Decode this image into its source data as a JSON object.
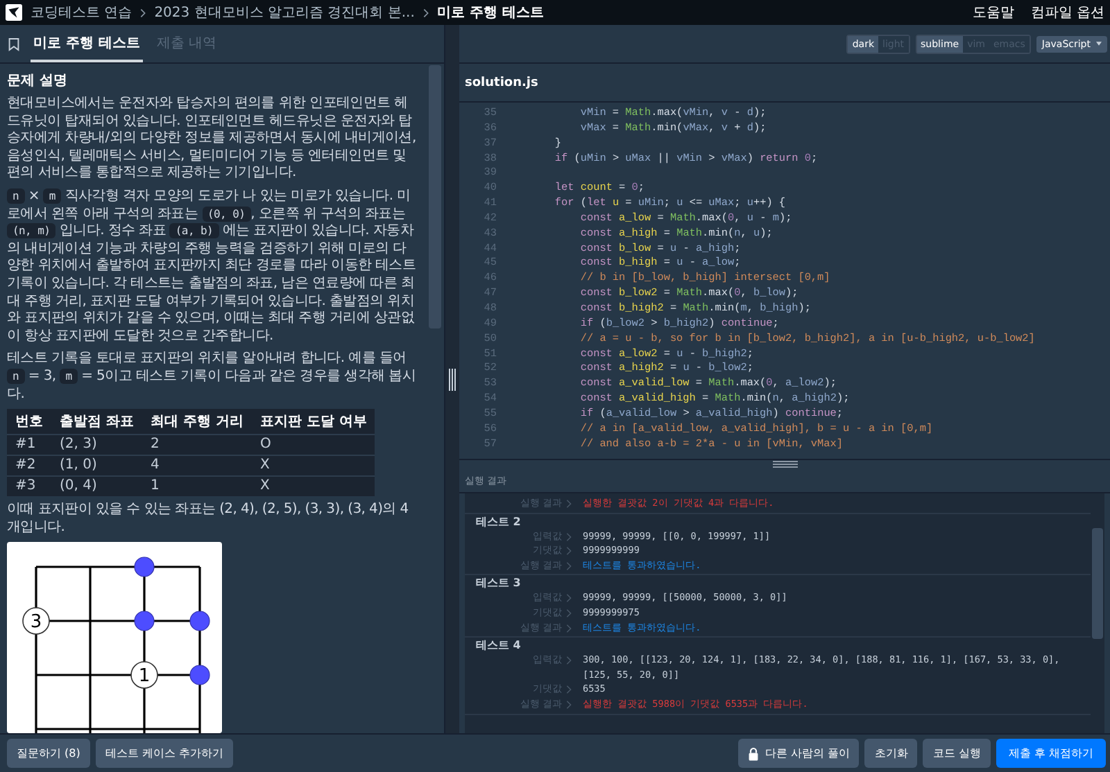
{
  "topbar": {
    "breadcrumbs": [
      {
        "label": "코딩테스트 연습",
        "current": false
      },
      {
        "label": "2023 현대모비스 알고리즘 경진대회 본...",
        "current": false
      },
      {
        "label": "미로 주행 테스트",
        "current": true
      }
    ],
    "links": [
      "도움말",
      "컴파일 옵션"
    ]
  },
  "left_tabs": [
    {
      "label": "미로 주행 테스트",
      "selected": true
    },
    {
      "label": "제출 내역",
      "selected": false
    }
  ],
  "problem": {
    "heading": "문제 설명",
    "paragraphs": [
      [
        {
          "kind": "text",
          "text": "현대모비스에서는 운전자와 탑승자의 편의를 위한 인포테인먼트 헤드유닛이 탑재되어 있습니다. 인포테인먼트 헤드유닛은 운전자와 탑승자에게 차량내/외의 다양한 정보를 제공하면서 동시에 내비게이션, 음성인식, 텔레매틱스 서비스, 멀티미디어 기능 등 엔터테인먼트 및 편의 서비스를 통합적으로 제공하는 기기입니다."
        }
      ],
      [
        {
          "kind": "code",
          "text": "n"
        },
        {
          "kind": "text",
          "text": " × "
        },
        {
          "kind": "code",
          "text": "m"
        },
        {
          "kind": "text",
          "text": " 직사각형 격자 모양의 도로가 나 있는 미로가 있습니다. 미로에서 왼쪽 아래 구석의 좌표는 "
        },
        {
          "kind": "code",
          "text": "(0, 0)"
        },
        {
          "kind": "text",
          "text": ", 오른쪽 위 구석의 좌표는 "
        },
        {
          "kind": "code",
          "text": "(n, m)"
        },
        {
          "kind": "text",
          "text": " 입니다. 정수 좌표 "
        },
        {
          "kind": "code",
          "text": "(a, b)"
        },
        {
          "kind": "text",
          "text": " 에는 표지판이 있습니다. 자동차의 내비게이션 기능과 차량의 주행 능력을 검증하기 위해 미로의 다양한 위치에서 출발하여 표지판까지 최단 경로를 따라 이동한 테스트 기록이 있습니다. 각 테스트는 출발점의 좌표, 남은 연료량에 따른 최대 주행 거리, 표지판 도달 여부가 기록되어 있습니다. 출발점의 위치와 표지판의 위치가 같을 수 있으며, 이때는 최대 주행 거리에 상관없이 항상 표지판에 도달한 것으로 간주합니다."
        }
      ],
      [
        {
          "kind": "text",
          "text": "테스트 기록을 토대로 표지판의 위치를 알아내려 합니다. 예를 들어 "
        },
        {
          "kind": "code",
          "text": "n"
        },
        {
          "kind": "text",
          "text": " = 3, "
        },
        {
          "kind": "code",
          "text": "m"
        },
        {
          "kind": "text",
          "text": " = 5이고 테스트 기록이 다음과 같은 경우를 생각해 봅시다."
        }
      ]
    ],
    "table": {
      "columns": [
        "번호",
        "출발점 좌표",
        "최대 주행 거리",
        "표지판 도달 여부"
      ],
      "rows": [
        [
          "#1",
          "(2, 3)",
          "2",
          "O"
        ],
        [
          "#2",
          "(1, 0)",
          "4",
          "X"
        ],
        [
          "#3",
          "(0, 4)",
          "1",
          "X"
        ]
      ]
    },
    "note": "이때 표지판이 있을 수 있는 좌표는 (2, 4), (2, 5), (3, 3), (3, 4)의 4개입니다.",
    "figure": {
      "nodes": [
        {
          "label": "3"
        },
        {
          "label": "1"
        }
      ]
    }
  },
  "editor": {
    "themes": [
      {
        "label": "dark",
        "selected": true
      },
      {
        "label": "light",
        "selected": false
      }
    ],
    "keymaps": [
      {
        "label": "sublime",
        "selected": true
      },
      {
        "label": "vim",
        "selected": false
      },
      {
        "label": "emacs",
        "selected": false
      }
    ],
    "language": "JavaScript",
    "file": "solution.js",
    "lines": [
      {
        "num": "35",
        "tokens": [
          {
            "kind": "i",
            "text": "            vMin"
          },
          {
            "kind": "p",
            "text": " = "
          },
          {
            "kind": "c",
            "text": "Math"
          },
          {
            "kind": "p",
            "text": ".max("
          },
          {
            "kind": "i",
            "text": "vMin"
          },
          {
            "kind": "p",
            "text": ", "
          },
          {
            "kind": "i",
            "text": "v"
          },
          {
            "kind": "p",
            "text": " - "
          },
          {
            "kind": "i",
            "text": "d"
          },
          {
            "kind": "p",
            "text": ");"
          }
        ]
      },
      {
        "num": "36",
        "tokens": [
          {
            "kind": "i",
            "text": "            vMax"
          },
          {
            "kind": "p",
            "text": " = "
          },
          {
            "kind": "c",
            "text": "Math"
          },
          {
            "kind": "p",
            "text": ".min("
          },
          {
            "kind": "i",
            "text": "vMax"
          },
          {
            "kind": "p",
            "text": ", "
          },
          {
            "kind": "i",
            "text": "v"
          },
          {
            "kind": "p",
            "text": " + "
          },
          {
            "kind": "i",
            "text": "d"
          },
          {
            "kind": "p",
            "text": ");"
          }
        ]
      },
      {
        "num": "37",
        "tokens": [
          {
            "kind": "p",
            "text": "        }"
          }
        ]
      },
      {
        "num": "38",
        "tokens": [
          {
            "kind": "k",
            "text": "        if"
          },
          {
            "kind": "p",
            "text": " ("
          },
          {
            "kind": "i",
            "text": "uMin"
          },
          {
            "kind": "p",
            "text": " > "
          },
          {
            "kind": "i",
            "text": "uMax"
          },
          {
            "kind": "p",
            "text": " || "
          },
          {
            "kind": "i",
            "text": "vMin"
          },
          {
            "kind": "p",
            "text": " > "
          },
          {
            "kind": "i",
            "text": "vMax"
          },
          {
            "kind": "p",
            "text": ") "
          },
          {
            "kind": "k",
            "text": "return"
          },
          {
            "kind": "n",
            "text": " 0"
          },
          {
            "kind": "p",
            "text": ";"
          }
        ]
      },
      {
        "num": "39"
      },
      {
        "num": "40",
        "tokens": [
          {
            "kind": "k",
            "text": "        let"
          },
          {
            "kind": "d",
            "text": " count"
          },
          {
            "kind": "p",
            "text": " = "
          },
          {
            "kind": "n",
            "text": "0"
          },
          {
            "kind": "p",
            "text": ";"
          }
        ]
      },
      {
        "num": "41",
        "tokens": [
          {
            "kind": "k",
            "text": "        for"
          },
          {
            "kind": "p",
            "text": " ("
          },
          {
            "kind": "k",
            "text": "let"
          },
          {
            "kind": "d",
            "text": " u"
          },
          {
            "kind": "p",
            "text": " = "
          },
          {
            "kind": "i",
            "text": "uMin"
          },
          {
            "kind": "p",
            "text": "; "
          },
          {
            "kind": "i",
            "text": "u"
          },
          {
            "kind": "p",
            "text": " <= "
          },
          {
            "kind": "i",
            "text": "uMax"
          },
          {
            "kind": "p",
            "text": "; "
          },
          {
            "kind": "i",
            "text": "u"
          },
          {
            "kind": "p",
            "text": "++) {"
          }
        ]
      },
      {
        "num": "42",
        "tokens": [
          {
            "kind": "k",
            "text": "            const"
          },
          {
            "kind": "d",
            "text": " a_low"
          },
          {
            "kind": "p",
            "text": " = "
          },
          {
            "kind": "c",
            "text": "Math"
          },
          {
            "kind": "p",
            "text": ".max("
          },
          {
            "kind": "n",
            "text": "0"
          },
          {
            "kind": "p",
            "text": ", "
          },
          {
            "kind": "i",
            "text": "u"
          },
          {
            "kind": "p",
            "text": " - "
          },
          {
            "kind": "i",
            "text": "m"
          },
          {
            "kind": "p",
            "text": ");"
          }
        ]
      },
      {
        "num": "43",
        "tokens": [
          {
            "kind": "k",
            "text": "            const"
          },
          {
            "kind": "d",
            "text": " a_high"
          },
          {
            "kind": "p",
            "text": " = "
          },
          {
            "kind": "c",
            "text": "Math"
          },
          {
            "kind": "p",
            "text": ".min("
          },
          {
            "kind": "i",
            "text": "n"
          },
          {
            "kind": "p",
            "text": ", "
          },
          {
            "kind": "i",
            "text": "u"
          },
          {
            "kind": "p",
            "text": ");"
          }
        ]
      },
      {
        "num": "44",
        "tokens": [
          {
            "kind": "k",
            "text": "            const"
          },
          {
            "kind": "d",
            "text": " b_low"
          },
          {
            "kind": "p",
            "text": " = "
          },
          {
            "kind": "i",
            "text": "u"
          },
          {
            "kind": "p",
            "text": " - "
          },
          {
            "kind": "i",
            "text": "a_high"
          },
          {
            "kind": "p",
            "text": ";"
          }
        ]
      },
      {
        "num": "45",
        "tokens": [
          {
            "kind": "k",
            "text": "            const"
          },
          {
            "kind": "d",
            "text": " b_high"
          },
          {
            "kind": "p",
            "text": " = "
          },
          {
            "kind": "i",
            "text": "u"
          },
          {
            "kind": "p",
            "text": " - "
          },
          {
            "kind": "i",
            "text": "a_low"
          },
          {
            "kind": "p",
            "text": ";"
          }
        ]
      },
      {
        "num": "46",
        "tokens": [
          {
            "kind": "x",
            "text": "            // b in [b_low, b_high] intersect [0,m]"
          }
        ]
      },
      {
        "num": "47",
        "tokens": [
          {
            "kind": "k",
            "text": "            const"
          },
          {
            "kind": "d",
            "text": " b_low2"
          },
          {
            "kind": "p",
            "text": " = "
          },
          {
            "kind": "c",
            "text": "Math"
          },
          {
            "kind": "p",
            "text": ".max("
          },
          {
            "kind": "n",
            "text": "0"
          },
          {
            "kind": "p",
            "text": ", "
          },
          {
            "kind": "i",
            "text": "b_low"
          },
          {
            "kind": "p",
            "text": ");"
          }
        ]
      },
      {
        "num": "48",
        "tokens": [
          {
            "kind": "k",
            "text": "            const"
          },
          {
            "kind": "d",
            "text": " b_high2"
          },
          {
            "kind": "p",
            "text": " = "
          },
          {
            "kind": "c",
            "text": "Math"
          },
          {
            "kind": "p",
            "text": ".min("
          },
          {
            "kind": "i",
            "text": "m"
          },
          {
            "kind": "p",
            "text": ", "
          },
          {
            "kind": "i",
            "text": "b_high"
          },
          {
            "kind": "p",
            "text": ");"
          }
        ]
      },
      {
        "num": "49",
        "tokens": [
          {
            "kind": "k",
            "text": "            if"
          },
          {
            "kind": "p",
            "text": " ("
          },
          {
            "kind": "i",
            "text": "b_low2"
          },
          {
            "kind": "p",
            "text": " > "
          },
          {
            "kind": "i",
            "text": "b_high2"
          },
          {
            "kind": "p",
            "text": ") "
          },
          {
            "kind": "k",
            "text": "continue"
          },
          {
            "kind": "p",
            "text": ";"
          }
        ]
      },
      {
        "num": "50",
        "tokens": [
          {
            "kind": "x",
            "text": "            // a = u - b, so for b in [b_low2, b_high2], a in [u-b_high2, u-b_low2]"
          }
        ]
      },
      {
        "num": "51",
        "tokens": [
          {
            "kind": "k",
            "text": "            const"
          },
          {
            "kind": "d",
            "text": " a_low2"
          },
          {
            "kind": "p",
            "text": " = "
          },
          {
            "kind": "i",
            "text": "u"
          },
          {
            "kind": "p",
            "text": " - "
          },
          {
            "kind": "i",
            "text": "b_high2"
          },
          {
            "kind": "p",
            "text": ";"
          }
        ]
      },
      {
        "num": "52",
        "tokens": [
          {
            "kind": "k",
            "text": "            const"
          },
          {
            "kind": "d",
            "text": " a_high2"
          },
          {
            "kind": "p",
            "text": " = "
          },
          {
            "kind": "i",
            "text": "u"
          },
          {
            "kind": "p",
            "text": " - "
          },
          {
            "kind": "i",
            "text": "b_low2"
          },
          {
            "kind": "p",
            "text": ";"
          }
        ]
      },
      {
        "num": "53",
        "tokens": [
          {
            "kind": "k",
            "text": "            const"
          },
          {
            "kind": "d",
            "text": " a_valid_low"
          },
          {
            "kind": "p",
            "text": " = "
          },
          {
            "kind": "c",
            "text": "Math"
          },
          {
            "kind": "p",
            "text": ".max("
          },
          {
            "kind": "n",
            "text": "0"
          },
          {
            "kind": "p",
            "text": ", "
          },
          {
            "kind": "i",
            "text": "a_low2"
          },
          {
            "kind": "p",
            "text": ");"
          }
        ]
      },
      {
        "num": "54",
        "tokens": [
          {
            "kind": "k",
            "text": "            const"
          },
          {
            "kind": "d",
            "text": " a_valid_high"
          },
          {
            "kind": "p",
            "text": " = "
          },
          {
            "kind": "c",
            "text": "Math"
          },
          {
            "kind": "p",
            "text": ".min("
          },
          {
            "kind": "i",
            "text": "n"
          },
          {
            "kind": "p",
            "text": ", "
          },
          {
            "kind": "i",
            "text": "a_high2"
          },
          {
            "kind": "p",
            "text": ");"
          }
        ]
      },
      {
        "num": "55",
        "tokens": [
          {
            "kind": "k",
            "text": "            if"
          },
          {
            "kind": "p",
            "text": " ("
          },
          {
            "kind": "i",
            "text": "a_valid_low"
          },
          {
            "kind": "p",
            "text": " > "
          },
          {
            "kind": "i",
            "text": "a_valid_high"
          },
          {
            "kind": "p",
            "text": ") "
          },
          {
            "kind": "k",
            "text": "continue"
          },
          {
            "kind": "p",
            "text": ";"
          }
        ]
      },
      {
        "num": "56",
        "tokens": [
          {
            "kind": "x",
            "text": "            // a in [a_valid_low, a_valid_high], b = u - a in [0,m]"
          }
        ]
      },
      {
        "num": "57",
        "tokens": [
          {
            "kind": "x",
            "text": "            // and also a-b = 2*a - u in [vMin, vMax]"
          }
        ]
      }
    ]
  },
  "results": {
    "title": "실행 결과",
    "entries": [
      {
        "rows": [
          {
            "kind": "result",
            "label": "실행 결과",
            "value": "실행한 결괏값 2이 기댓값 4과 다릅니다.",
            "passed": false
          }
        ]
      },
      {
        "title": "테스트 2",
        "rows": [
          {
            "kind": "input",
            "label": "입력값",
            "value": "99999, 99999, [[0, 0, 199997, 1]]"
          },
          {
            "kind": "expected",
            "label": "기댓값",
            "value": "9999999999"
          },
          {
            "kind": "result",
            "label": "실행 결과",
            "value": "테스트를 통과하였습니다.",
            "passed": true
          }
        ]
      },
      {
        "title": "테스트 3",
        "rows": [
          {
            "kind": "input",
            "label": "입력값",
            "value": "99999, 99999, [[50000, 50000, 3, 0]]"
          },
          {
            "kind": "expected",
            "label": "기댓값",
            "value": "9999999975"
          },
          {
            "kind": "result",
            "label": "실행 결과",
            "value": "테스트를 통과하였습니다.",
            "passed": true
          }
        ]
      },
      {
        "title": "테스트 4",
        "rows": [
          {
            "kind": "input",
            "label": "입력값",
            "value": "300, 100, [[123, 20, 124, 1], [183, 22, 34, 0], [188, 81, 116, 1], [167, 53, 33, 0], [125, 55, 20, 0]]"
          },
          {
            "kind": "expected",
            "label": "기댓값",
            "value": "6535"
          },
          {
            "kind": "result",
            "label": "실행 결과",
            "value": "실행한 결괏값 5988이 기댓값 6535과 다릅니다.",
            "passed": false
          }
        ]
      }
    ]
  },
  "footer": {
    "left_buttons": [
      "질문하기 (8)",
      "테스트 케이스 추가하기"
    ],
    "right_buttons": [
      {
        "label": "다른 사람의 풀이",
        "kind": "locked"
      },
      {
        "label": "초기화",
        "kind": "plain"
      },
      {
        "label": "코드 실행",
        "kind": "plain"
      },
      {
        "label": "제출 후 채점하기",
        "kind": "primary"
      }
    ]
  }
}
